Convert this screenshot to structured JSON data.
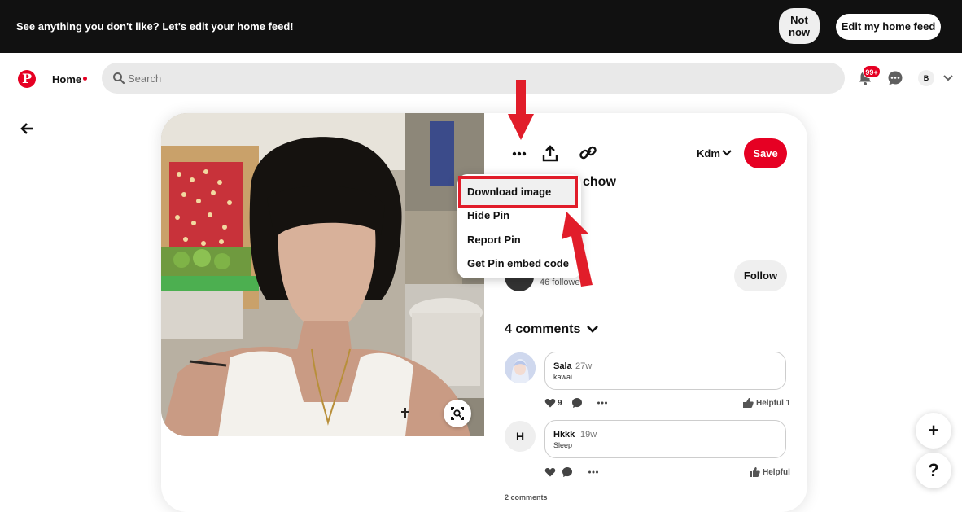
{
  "banner": {
    "message": "See anything you don't like? Let's edit your home feed!",
    "not_now_label": "Not now",
    "edit_label": "Edit my home feed"
  },
  "header": {
    "logo_glyph": "P",
    "home_label": "Home",
    "search_placeholder": "Search",
    "notifications_badge": "99+",
    "avatar_initial": "B"
  },
  "pin": {
    "board_name": "Kdm",
    "save_label": "Save",
    "title_fragment": "chow",
    "creator_followers": "46 followe",
    "follow_label": "Follow"
  },
  "more_menu": {
    "items": [
      "Download image",
      "Hide Pin",
      "Report Pin",
      "Get Pin embed code"
    ]
  },
  "comments": {
    "header": "4 comments",
    "list": [
      {
        "author": "Sala",
        "time": "27w",
        "text": "kawai",
        "likes": "9",
        "helpful": "Helpful 1"
      },
      {
        "author": "Hkkk",
        "time": "19w",
        "text": "Sleep",
        "avatar_initial": "H",
        "helpful": "Helpful"
      }
    ],
    "more_label": "2 comments"
  },
  "fab": {
    "create": "+",
    "help": "?"
  },
  "colors": {
    "brand": "#e60023",
    "annotation": "#e11d2a",
    "banner_bg": "#111111"
  }
}
